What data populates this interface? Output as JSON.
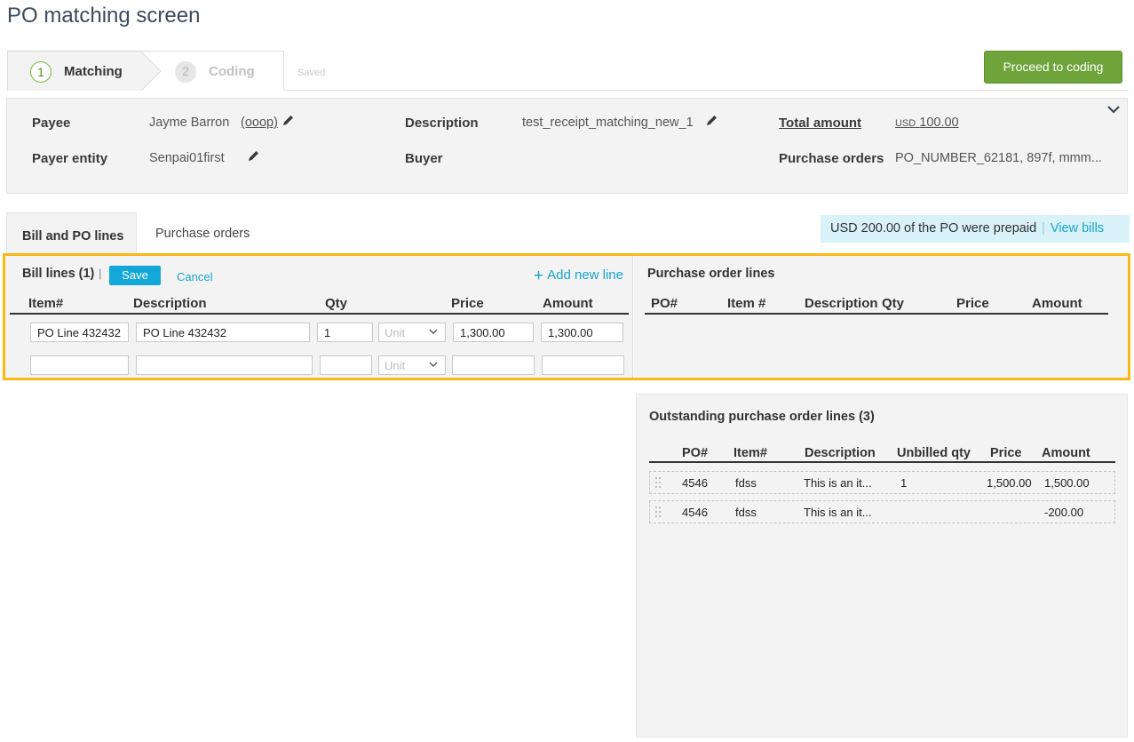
{
  "page": {
    "title": "PO matching screen"
  },
  "stepper": {
    "steps": [
      {
        "number": "1",
        "label": "Matching"
      },
      {
        "number": "2",
        "label": "Coding"
      }
    ],
    "saved_label": "Saved",
    "proceed_label": "Proceed to coding"
  },
  "header": {
    "payee_label": "Payee",
    "payee_value": "Jayme Barron",
    "payee_link": "(ooop)",
    "payer_entity_label": "Payer entity",
    "payer_entity_value": "Senpai01first",
    "description_label": "Description",
    "description_value": "test_receipt_matching_new_1",
    "buyer_label": "Buyer",
    "total_amount_label": "Total amount",
    "total_currency": "USD",
    "total_value": "100.00",
    "purchase_orders_label": "Purchase orders",
    "purchase_orders_value": "PO_NUMBER_62181, 897f, mmm..."
  },
  "tabs": [
    {
      "label": "Bill and PO lines"
    },
    {
      "label": "Purchase orders"
    }
  ],
  "prepaid": {
    "text": "USD 200.00 of the PO were prepaid",
    "separator": "|",
    "link": "View bills"
  },
  "bill_lines": {
    "title": "Bill lines (1)",
    "separator": "|",
    "save_label": "Save",
    "cancel_label": "Cancel",
    "add_line_label": "Add new line",
    "add_line_icon": "+",
    "columns": [
      "Item#",
      "Description",
      "Qty",
      "Price",
      "Amount"
    ],
    "rows": [
      {
        "item": "PO Line 432432",
        "description": "PO Line 432432",
        "qty": "1",
        "unit": "Unit",
        "price": "1,300.00",
        "amount": "1,300.00"
      },
      {
        "item": "",
        "description": "",
        "qty": "",
        "unit": "Unit",
        "price": "",
        "amount": ""
      }
    ]
  },
  "po_lines": {
    "title": "Purchase order lines",
    "columns": [
      "PO#",
      "Item #",
      "Description",
      "Qty",
      "Price",
      "Amount"
    ]
  },
  "outstanding": {
    "title": "Outstanding purchase order lines (3)",
    "columns": [
      "PO#",
      "Item#",
      "Description",
      "Unbilled qty",
      "Price",
      "Amount"
    ],
    "rows": [
      {
        "po": "4546",
        "item": "fdss",
        "description": "This is an it...",
        "qty": "1",
        "price": "1,500.00",
        "amount": "1,500.00"
      },
      {
        "po": "4546",
        "item": "fdss",
        "description": "This is an it...",
        "qty": "",
        "price": "",
        "amount": "-200.00"
      }
    ]
  },
  "colors": {
    "accent": "#17a6cc",
    "primary_button": "#6ea43a",
    "highlight_border": "#f6b915",
    "save_button": "#12a8d9"
  }
}
